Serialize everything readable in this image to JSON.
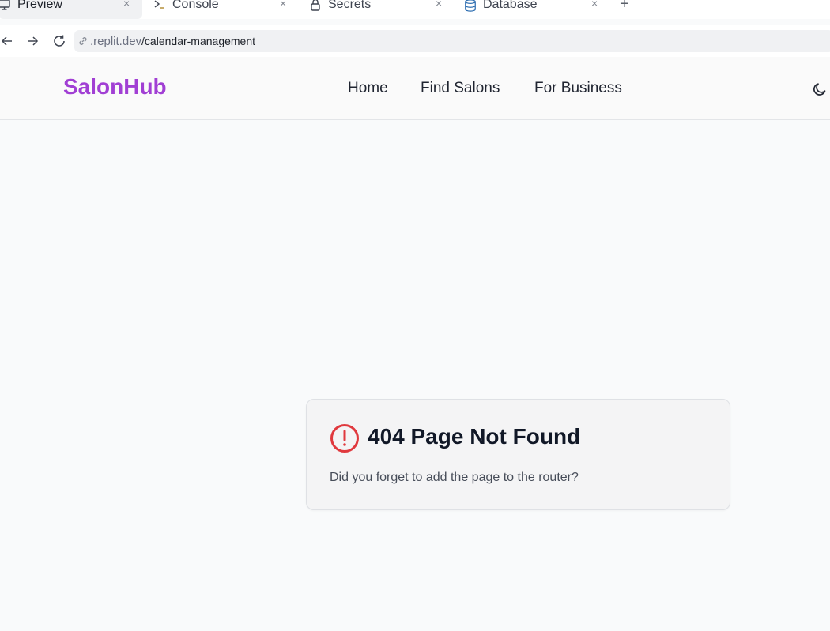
{
  "tabs": [
    {
      "label": "Preview",
      "icon": "monitor-icon",
      "active": true
    },
    {
      "label": "Console",
      "icon": "terminal-icon",
      "active": false
    },
    {
      "label": "Secrets",
      "icon": "lock-icon",
      "active": false
    },
    {
      "label": "Database",
      "icon": "database-icon",
      "active": false
    }
  ],
  "tab_close_glyph": "×",
  "new_tab_glyph": "+",
  "address": {
    "host": ".replit.dev",
    "path": "/calendar-management"
  },
  "header": {
    "brand": "SalonHub",
    "nav": [
      "Home",
      "Find Salons",
      "For Business"
    ]
  },
  "error_card": {
    "title": "404 Page Not Found",
    "description": "Did you forget to add the page to the router?"
  },
  "colors": {
    "brand": "#a13fd4",
    "alert": "#e0393e",
    "database_icon": "#2b6cb0"
  }
}
